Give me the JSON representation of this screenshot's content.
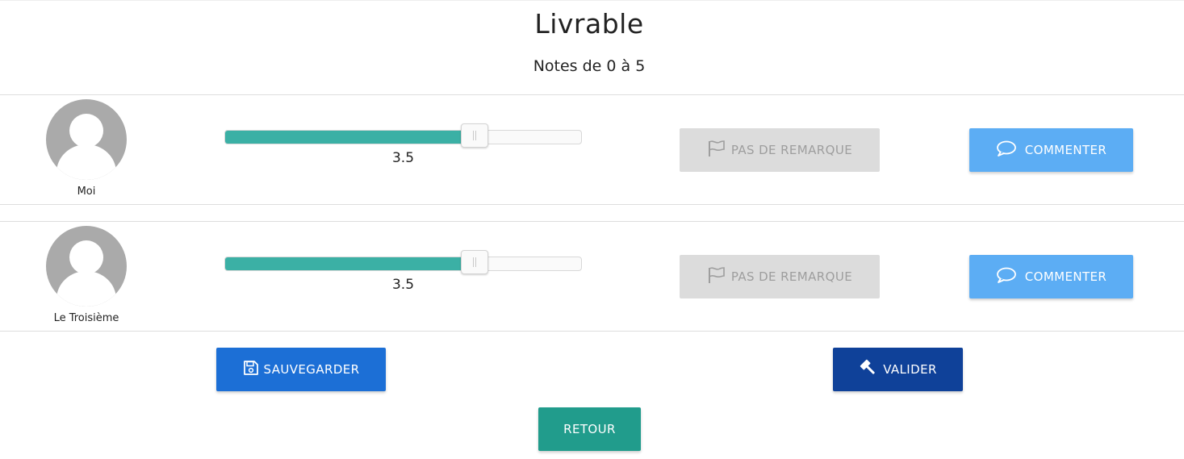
{
  "header": {
    "title": "Livrable",
    "subtitle": "Notes de 0 à 5"
  },
  "rating_scale": {
    "min": 0,
    "max": 5
  },
  "members": [
    {
      "name": "Moi",
      "avatar_icon": "user-avatar-icon",
      "score": 3.5,
      "score_label": "3.5",
      "remark_button": {
        "label": "PAS DE REMARQUE",
        "icon": "flag-icon",
        "state": "disabled"
      },
      "comment_button": {
        "label": "COMMENTER",
        "icon": "comment-icon"
      }
    },
    {
      "name": "Le Troisième",
      "avatar_icon": "user-avatar-icon",
      "score": 3.5,
      "score_label": "3.5",
      "remark_button": {
        "label": "PAS DE REMARQUE",
        "icon": "flag-icon",
        "state": "disabled"
      },
      "comment_button": {
        "label": "COMMENTER",
        "icon": "comment-icon"
      }
    }
  ],
  "actions": {
    "save": {
      "label": "SAUVEGARDER",
      "icon": "floppy-disk-icon"
    },
    "validate": {
      "label": "VALIDER",
      "icon": "gavel-icon"
    },
    "back": {
      "label": "RETOUR"
    }
  },
  "colors": {
    "slider_fill": "#3bb0a5",
    "comment_button": "#5cadf4",
    "remark_button_disabled": "#dcdcdc",
    "save_button": "#1c6fd6",
    "validate_button": "#0f4199",
    "back_button": "#219c8c"
  }
}
